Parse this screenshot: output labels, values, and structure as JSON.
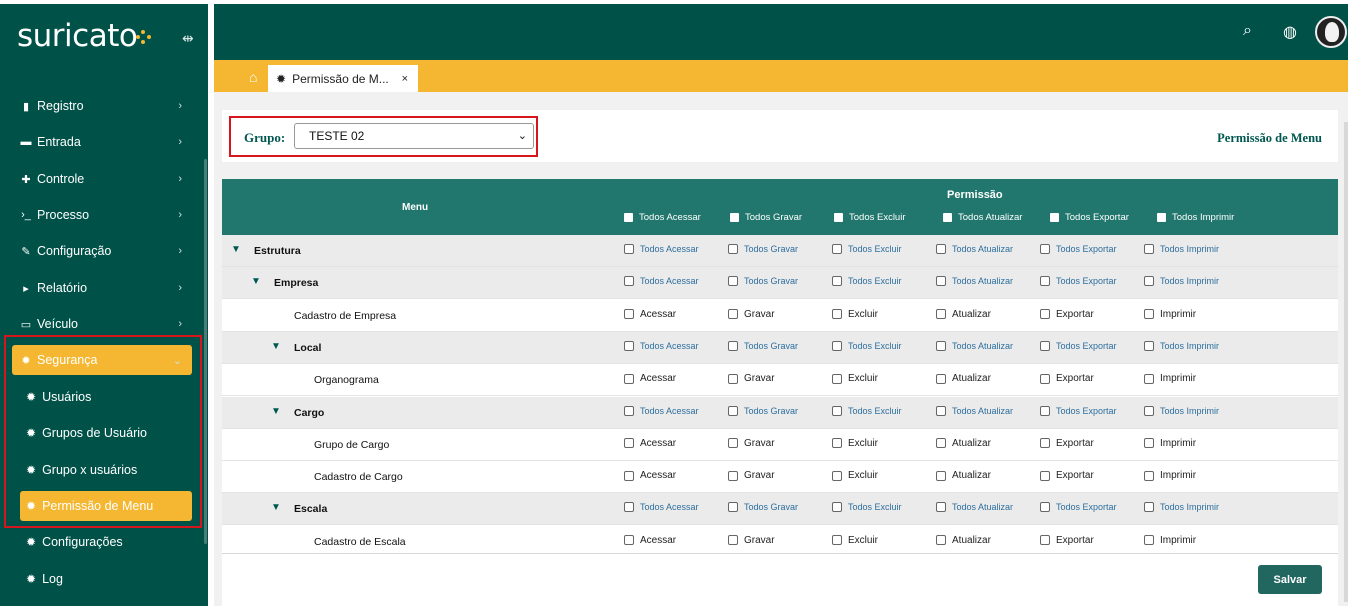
{
  "brand": "suricato",
  "sidebar": {
    "items": [
      {
        "label": "Registro",
        "icon": "book-icon"
      },
      {
        "label": "Entrada",
        "icon": "inbox-icon"
      },
      {
        "label": "Controle",
        "icon": "puzzle-icon"
      },
      {
        "label": "Processo",
        "icon": "terminal-icon"
      },
      {
        "label": "Configuração",
        "icon": "wrench-icon"
      },
      {
        "label": "Relatório",
        "icon": "report-icon"
      },
      {
        "label": "Veículo",
        "icon": "car-icon"
      },
      {
        "label": "Segurança",
        "icon": "gear-icon"
      }
    ],
    "sub_items": [
      {
        "label": "Usuários"
      },
      {
        "label": "Grupos de Usuário"
      },
      {
        "label": "Grupo x usuários"
      },
      {
        "label": "Permissão de Menu"
      },
      {
        "label": "Configurações"
      },
      {
        "label": "Log"
      }
    ]
  },
  "tab": {
    "label": "Permissão de M...",
    "close": "×"
  },
  "filter": {
    "label": "Grupo:",
    "selected": "TESTE 02",
    "title": "Permissão de Menu"
  },
  "table": {
    "menu_header": "Menu",
    "permission_header": "Permissão",
    "header_checks": [
      "Todos Acessar",
      "Todos Gravar",
      "Todos Excluir",
      "Todos Atualizar",
      "Todos Exportar",
      "Todos Imprimir"
    ],
    "group_checks": [
      "Todos Acessar",
      "Todos Gravar",
      "Todos Excluir",
      "Todos Atualizar",
      "Todos Exportar",
      "Todos Imprimir"
    ],
    "leaf_checks": [
      "Acessar",
      "Gravar",
      "Excluir",
      "Atualizar",
      "Exportar",
      "Imprimir"
    ],
    "rows": [
      {
        "label": "Estrutura",
        "type": "group",
        "level": 0
      },
      {
        "label": "Empresa",
        "type": "group",
        "level": 1
      },
      {
        "label": "Cadastro de Empresa",
        "type": "leaf",
        "level": 2
      },
      {
        "label": "Local",
        "type": "group",
        "level": 2
      },
      {
        "label": "Organograma",
        "type": "leaf",
        "level": 3
      },
      {
        "label": "Cargo",
        "type": "group",
        "level": 2
      },
      {
        "label": "Grupo de Cargo",
        "type": "leaf",
        "level": 3
      },
      {
        "label": "Cadastro de Cargo",
        "type": "leaf",
        "level": 3
      },
      {
        "label": "Escala",
        "type": "group",
        "level": 2
      },
      {
        "label": "Cadastro de Escala",
        "type": "leaf",
        "level": 3
      }
    ]
  },
  "save_label": "Salvar",
  "colors": {
    "sidebar": "#005249",
    "accent": "#f5b731",
    "table_header": "#21776d"
  }
}
